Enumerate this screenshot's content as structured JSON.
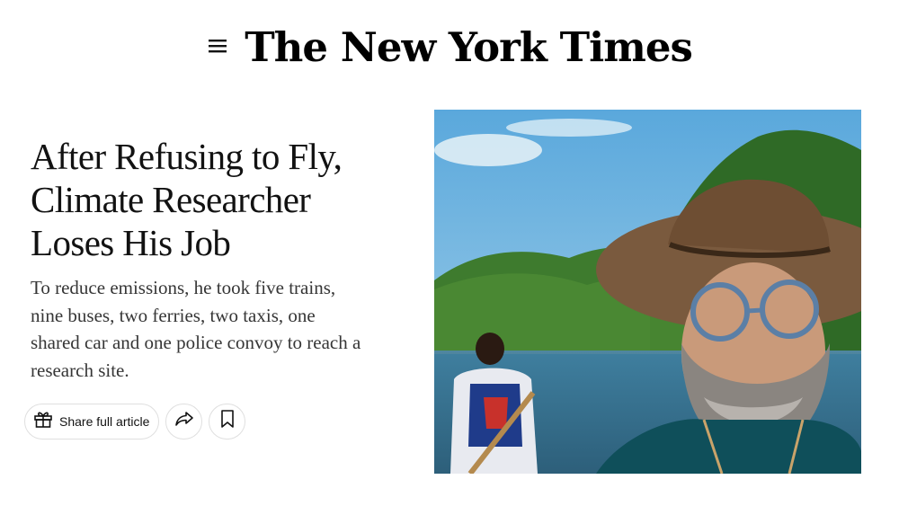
{
  "header": {
    "masthead": "The New York Times",
    "menu_icon": "hamburger-menu-icon"
  },
  "article": {
    "headline_lines": [
      "After Refusing to Fly,",
      "Climate Researcher",
      "Loses His Job"
    ],
    "summary_lines": [
      "To reduce emissions, he took five trains,",
      "nine buses, two ferries, two taxis, one",
      "shared car and one police convoy to reach a",
      "research site."
    ]
  },
  "share_bar": {
    "share_label": "Share full article",
    "gift_icon": "gift-icon",
    "forward_icon": "share-arrow-icon",
    "bookmark_icon": "bookmark-icon"
  },
  "colors": {
    "text": "#121212",
    "summary_text": "#363636",
    "border": "#dfdfdf"
  }
}
